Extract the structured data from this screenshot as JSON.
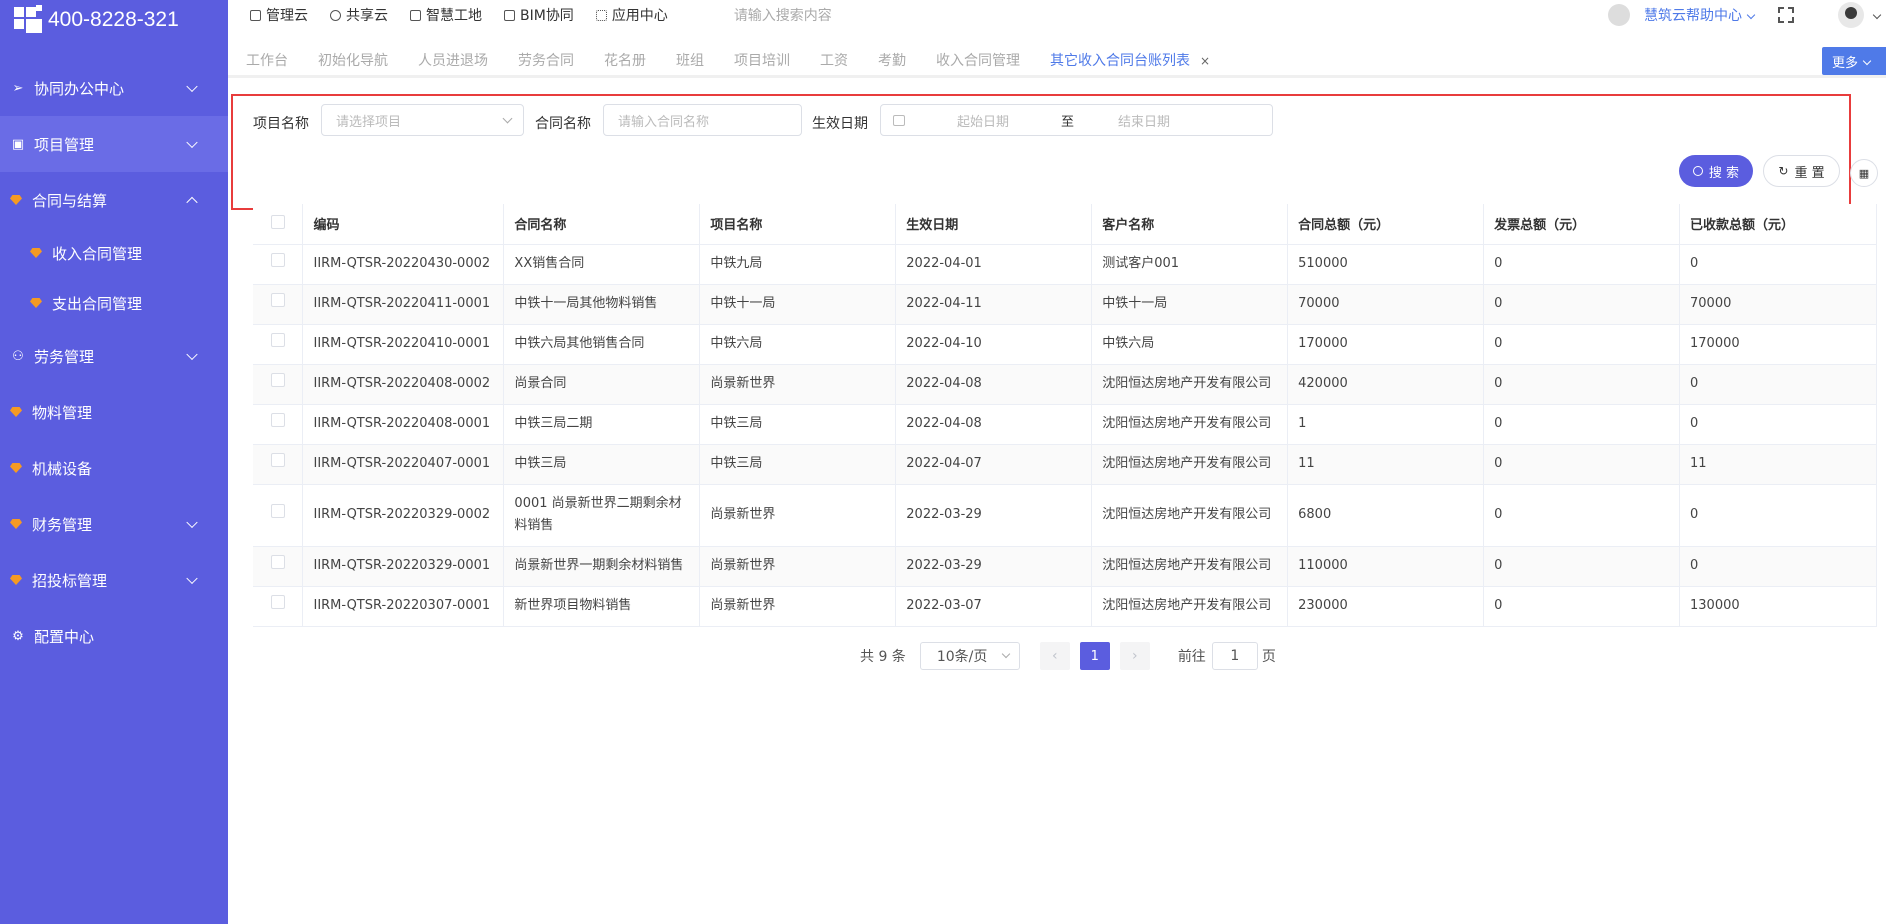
{
  "brand": {
    "phone": "400-8228-321"
  },
  "sidebar": {
    "items": [
      {
        "label": "协同办公中心",
        "icon": "send-icon"
      },
      {
        "label": "项目管理",
        "icon": "book-icon"
      },
      {
        "label": "合同与结算",
        "icon": "gem-icon"
      },
      {
        "label": "收入合同管理",
        "icon": "gem-icon"
      },
      {
        "label": "支出合同管理",
        "icon": "gem-icon"
      },
      {
        "label": "劳务管理",
        "icon": "user-icon"
      },
      {
        "label": "物料管理",
        "icon": "gem-icon"
      },
      {
        "label": "机械设备",
        "icon": "gem-icon"
      },
      {
        "label": "财务管理",
        "icon": "gem-icon"
      },
      {
        "label": "招投标管理",
        "icon": "gem-icon"
      },
      {
        "label": "配置中心",
        "icon": "gear-icon"
      }
    ]
  },
  "topnav": {
    "links": [
      {
        "label": "管理云",
        "icon": "doc-icon"
      },
      {
        "label": "共享云",
        "icon": "cloud-icon"
      },
      {
        "label": "智慧工地",
        "icon": "doc-icon"
      },
      {
        "label": "BIM协同",
        "icon": "cube-icon"
      },
      {
        "label": "应用中心",
        "icon": "grid-icon"
      }
    ],
    "search_placeholder": "请输入搜索内容",
    "help": "慧筑云帮助中心"
  },
  "tabs": {
    "items": [
      "工作台",
      "初始化导航",
      "人员进退场",
      "劳务合同",
      "花名册",
      "班组",
      "项目培训",
      "工资",
      "考勤",
      "收入合同管理",
      "其它收入合同台账列表"
    ],
    "close": "×",
    "more": "更多"
  },
  "search": {
    "project_label": "项目名称",
    "project_placeholder": "请选择项目",
    "contract_label": "合同名称",
    "contract_placeholder": "请输入合同名称",
    "date_label": "生效日期",
    "date_start": "起始日期",
    "date_sep": "至",
    "date_end": "结束日期",
    "search_btn": "搜 索",
    "reset_btn": "重 置"
  },
  "table": {
    "headers": [
      "编码",
      "合同名称",
      "项目名称",
      "生效日期",
      "客户名称",
      "合同总额（元）",
      "发票总额（元）",
      "已收款总额（元）"
    ],
    "rows": [
      [
        "IIRM-QTSR-20220430-0002",
        "XX销售合同",
        "中铁九局",
        "2022-04-01",
        "测试客户001",
        "510000",
        "0",
        "0"
      ],
      [
        "IIRM-QTSR-20220411-0001",
        "中铁十一局其他物料销售",
        "中铁十一局",
        "2022-04-11",
        "中铁十一局",
        "70000",
        "0",
        "70000"
      ],
      [
        "IIRM-QTSR-20220410-0001",
        "中铁六局其他销售合同",
        "中铁六局",
        "2022-04-10",
        "中铁六局",
        "170000",
        "0",
        "170000"
      ],
      [
        "IIRM-QTSR-20220408-0002",
        "尚景合同",
        "尚景新世界",
        "2022-04-08",
        "沈阳恒达房地产开发有限公司",
        "420000",
        "0",
        "0"
      ],
      [
        "IIRM-QTSR-20220408-0001",
        "中铁三局二期",
        "中铁三局",
        "2022-04-08",
        "沈阳恒达房地产开发有限公司",
        "1",
        "0",
        "0"
      ],
      [
        "IIRM-QTSR-20220407-0001",
        "中铁三局",
        "中铁三局",
        "2022-04-07",
        "沈阳恒达房地产开发有限公司",
        "11",
        "0",
        "11"
      ],
      [
        "IIRM-QTSR-20220329-0002",
        "0001 尚景新世界二期剩余材料销售",
        "尚景新世界",
        "2022-03-29",
        "沈阳恒达房地产开发有限公司",
        "6800",
        "0",
        "0"
      ],
      [
        "IIRM-QTSR-20220329-0001",
        "尚景新世界一期剩余材料销售",
        "尚景新世界",
        "2022-03-29",
        "沈阳恒达房地产开发有限公司",
        "110000",
        "0",
        "0"
      ],
      [
        "IIRM-QTSR-20220307-0001",
        "新世界项目物料销售",
        "尚景新世界",
        "2022-03-07",
        "沈阳恒达房地产开发有限公司",
        "230000",
        "0",
        "130000"
      ]
    ]
  },
  "pager": {
    "total": "共 9 条",
    "size": "10条/页",
    "prev": "‹",
    "page": "1",
    "next": "›",
    "goto": "前往",
    "goto_value": "1",
    "unit": "页"
  },
  "colors": {
    "sidebar": "#5b5ddf",
    "accent": "#4f7ae8",
    "highlight_border": "#e83c3c"
  }
}
